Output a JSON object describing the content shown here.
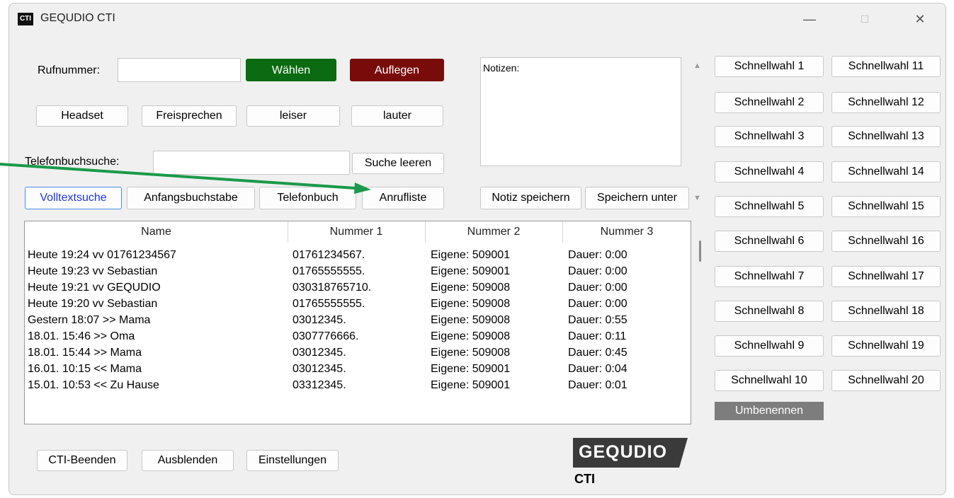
{
  "window": {
    "title": "GEQUDIO CTI",
    "app_icon_text": "CTI",
    "controls": {
      "minimize": "—",
      "maximize": "☐",
      "close": "✕"
    }
  },
  "dial": {
    "phone_label": "Rufnummer:",
    "phone_value": "",
    "dial_button": "Wählen",
    "hangup_button": "Auflegen",
    "headset_button": "Headset",
    "speaker_button": "Freisprechen",
    "quieter_button": "leiser",
    "louder_button": "lauter"
  },
  "search": {
    "label": "Telefonbuchsuche:",
    "value": "",
    "clear_button": "Suche leeren",
    "tabs": [
      {
        "label": "Volltextsuche",
        "selected": true
      },
      {
        "label": "Anfangsbuchstabe",
        "selected": false
      },
      {
        "label": "Telefonbuch",
        "selected": false
      },
      {
        "label": "Anrufliste",
        "selected": false
      }
    ]
  },
  "notes": {
    "label": "Notizen:",
    "save_button": "Notiz speichern",
    "save_as_button": "Speichern unter"
  },
  "calllist": {
    "columns": [
      "Name",
      "Nummer 1",
      "Nummer 2",
      "Nummer 3"
    ],
    "rows": [
      [
        "Heute 19:24 vv 01761234567",
        "01761234567.",
        "Eigene:  509001",
        "Dauer: 0:00"
      ],
      [
        "Heute 19:23 vv Sebastian",
        "01765555555.",
        "Eigene:  509001",
        "Dauer: 0:00"
      ],
      [
        "Heute 19:21 vv GEQUDIO",
        "030318765710.",
        "Eigene:  509008",
        "Dauer: 0:00"
      ],
      [
        "Heute 19:20 vv Sebastian",
        "01765555555.",
        "Eigene:  509008",
        "Dauer: 0:00"
      ],
      [
        "Gestern 18:07 >> Mama",
        "03012345.",
        "Eigene: 509008",
        "Dauer: 0:55"
      ],
      [
        "18.01. 15:46 >> Oma",
        "0307776666.",
        "Eigene: 509008",
        "Dauer: 0:11"
      ],
      [
        "18.01. 15:44 >> Mama",
        "03012345.",
        "Eigene: 509008",
        "Dauer: 0:45"
      ],
      [
        "16.01. 10:15 << Mama",
        "03012345.",
        "Eigene: 509001",
        "Dauer: 0:04"
      ],
      [
        "15.01. 10:53 << Zu Hause",
        "03312345.",
        "Eigene:  509001",
        "Dauer: 0:01"
      ]
    ]
  },
  "speeddial": {
    "scroll_up": "▲",
    "scroll_down": "▼",
    "left": [
      "Schnellwahl 1",
      "Schnellwahl 2",
      "Schnellwahl 3",
      "Schnellwahl 4",
      "Schnellwahl 5",
      "Schnellwahl 6",
      "Schnellwahl 7",
      "Schnellwahl 8",
      "Schnellwahl 9",
      "Schnellwahl 10"
    ],
    "right": [
      "Schnellwahl 11",
      "Schnellwahl 12",
      "Schnellwahl 13",
      "Schnellwahl 14",
      "Schnellwahl 15",
      "Schnellwahl 16",
      "Schnellwahl 17",
      "Schnellwahl 18",
      "Schnellwahl 19",
      "Schnellwahl 20"
    ],
    "rename_button": "Umbenennen"
  },
  "footer": {
    "exit_button": "CTI-Beenden",
    "hide_button": "Ausblenden",
    "settings_button": "Einstellungen",
    "logo_main": "GEQUDIO",
    "logo_sub": "CTI"
  },
  "colors": {
    "dial": "#0a6b12",
    "hangup": "#7a0b0b",
    "rename": "#7d7d7d",
    "annotation_arrow": "#1a9a4a",
    "selected_tab_text": "#1e33e6"
  }
}
